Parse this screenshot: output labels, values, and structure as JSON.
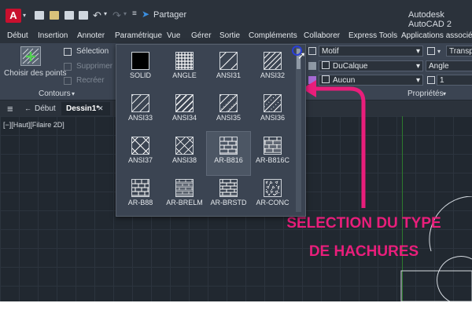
{
  "titlebar": {
    "share_label": "Partager",
    "app_title": "Autodesk AutoCAD 2"
  },
  "menu": [
    "Début",
    "Insertion",
    "Annoter",
    "Paramétrique",
    "Vue",
    "Gérer",
    "Sortie",
    "Compléments",
    "Collaborer",
    "Express Tools",
    "Applications associées"
  ],
  "ribbon": {
    "choose_points": "Choisir des points",
    "selection": "Sélection",
    "remove": "Supprimer",
    "recreate": "Recréer",
    "contours_panel": "Contours",
    "properties_panel": "Propriétés",
    "motif": "Motif",
    "ducalque": "DuCalque",
    "aucun": "Aucun",
    "transparency": "Transpa",
    "angle": "Angle",
    "scale_value": "1"
  },
  "tabs": {
    "debut": "Début",
    "dessin": "Dessin1*"
  },
  "viewport": {
    "label": "[−][Haut][Filaire 2D]"
  },
  "hatches": [
    "SOLID",
    "ANGLE",
    "ANSI31",
    "ANSI32",
    "ANSI33",
    "ANSI34",
    "ANSI35",
    "ANSI36",
    "ANSI37",
    "ANSI38",
    "AR-B816",
    "AR-B816C",
    "AR-B88",
    "AR-BRELM",
    "AR-BRSTD",
    "AR-CONC"
  ],
  "selected_hatch": "AR-B816",
  "annotation": {
    "line1": "SÉLECTION DU TYPE",
    "line2": "DE HACHURES"
  },
  "colors": {
    "annotation": "#e91e7b",
    "accent": "#3b8fe0"
  }
}
